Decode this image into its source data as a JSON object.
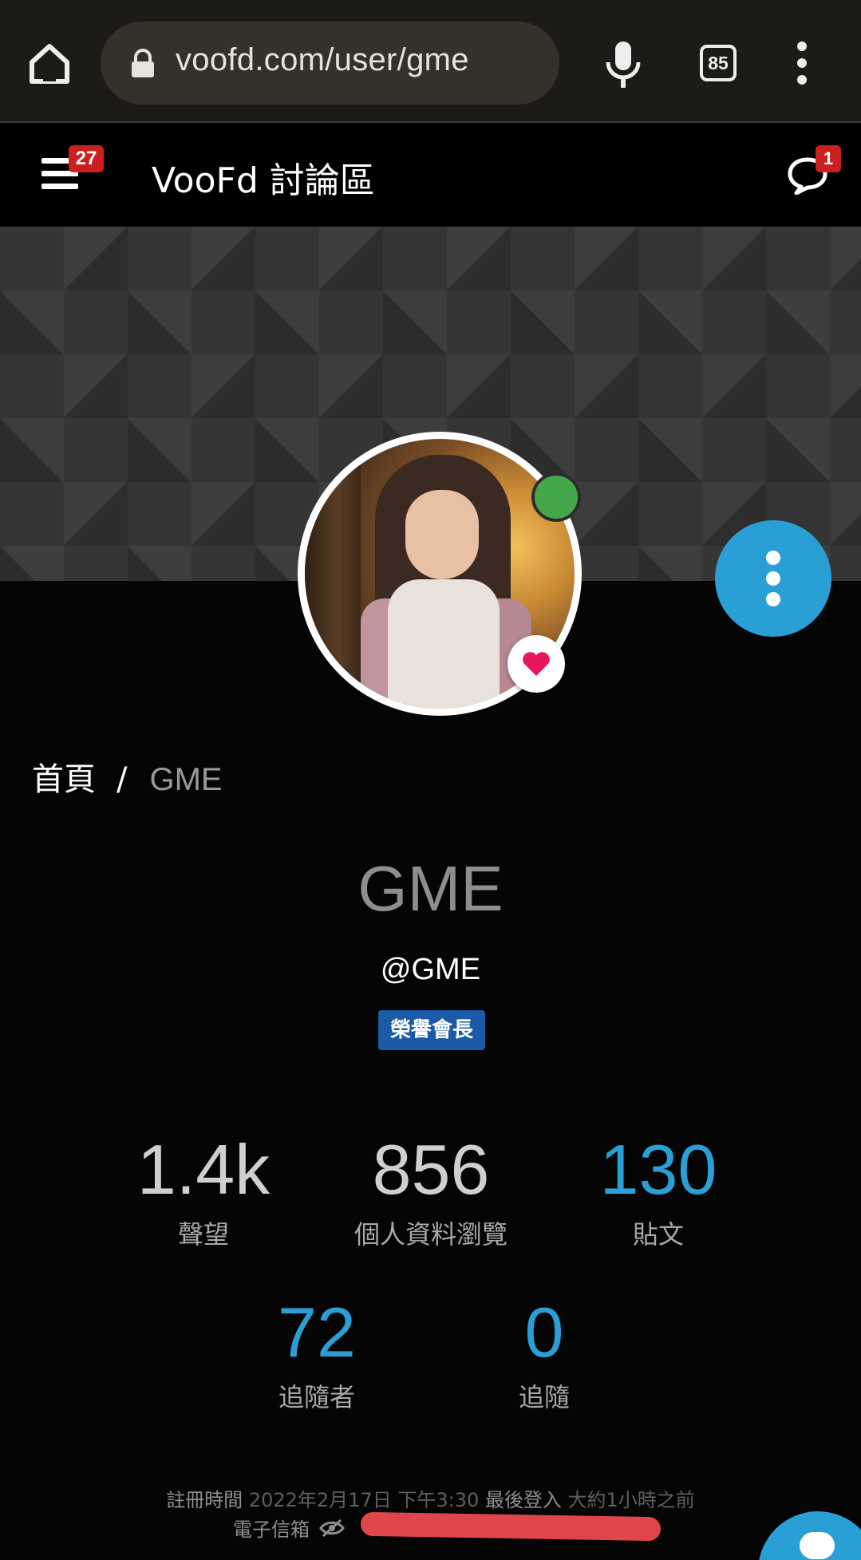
{
  "browser": {
    "url": "voofd.com/user/gme",
    "tab_count": "85"
  },
  "header": {
    "title": "VooFd 討論區",
    "menu_badge": "27",
    "chat_badge": "1"
  },
  "breadcrumb": {
    "home": "首頁",
    "separator": "/",
    "current": "GME"
  },
  "profile": {
    "display_name": "GME",
    "handle": "@GME",
    "group_badge": "榮譽會長",
    "online_status_color": "#44a84a"
  },
  "stats": [
    {
      "value": "1.4k",
      "label": "聲望"
    },
    {
      "value": "856",
      "label": "個人資料瀏覽"
    },
    {
      "value": "130",
      "label": "貼文"
    },
    {
      "value": "72",
      "label": "追隨者"
    },
    {
      "value": "0",
      "label": "追隨"
    }
  ],
  "info": {
    "joined_label": "註冊時間",
    "joined_value": "2022年2月17日 下午3:30",
    "last_online_label": "最後登入",
    "last_online_value": "大約1小時之前",
    "email_label": "電子信箱"
  },
  "colors": {
    "accent": "#2a9fd6",
    "badge_red": "#cc1f1f",
    "group_badge": "#1a5aa6",
    "heart": "#e8175d"
  },
  "icons": [
    "home-icon",
    "lock-icon",
    "mic-icon",
    "more-vert-icon",
    "menu-icon",
    "chat-icon",
    "heart-icon",
    "eye-off-icon",
    "chat-fab-icon"
  ]
}
